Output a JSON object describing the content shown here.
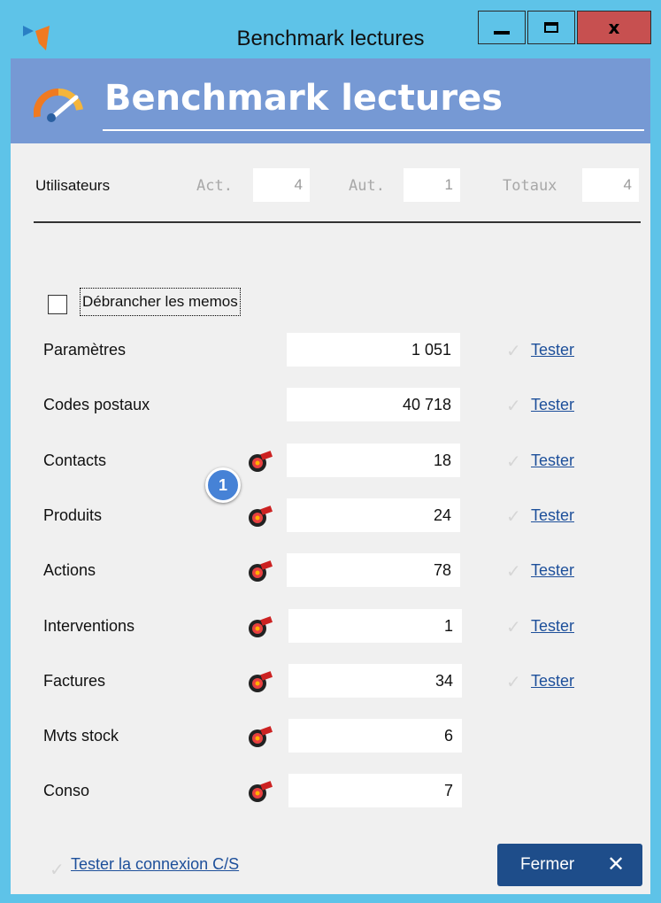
{
  "window": {
    "title": "Benchmark lectures",
    "controls": {
      "minimize": "minimize",
      "maximize": "maximize",
      "close": "x"
    }
  },
  "header": {
    "title": "Benchmark lectures",
    "icon": "speedometer-icon"
  },
  "users": {
    "label": "Utilisateurs",
    "fields": [
      {
        "label": "Act.",
        "value": "4"
      },
      {
        "label": "Aut.",
        "value": "1"
      },
      {
        "label": "Totaux",
        "value": "4"
      }
    ]
  },
  "memos_checkbox": {
    "label": "Débrancher les memos",
    "checked": false
  },
  "rows": [
    {
      "label": "Paramètres",
      "value": "1 051",
      "tester": "Tester",
      "has_icon": false
    },
    {
      "label": "Codes postaux",
      "value": "40 718",
      "tester": "Tester",
      "has_icon": false
    },
    {
      "label": "Contacts",
      "value": "18",
      "tester": "Tester",
      "has_icon": true
    },
    {
      "label": "Produits",
      "value": "24",
      "tester": "Tester",
      "has_icon": true
    },
    {
      "label": "Actions",
      "value": "78",
      "tester": "Tester",
      "has_icon": true
    },
    {
      "label": "Interventions",
      "value": "1",
      "tester": "Tester",
      "has_icon": true
    },
    {
      "label": "Factures",
      "value": "34",
      "tester": "Tester",
      "has_icon": true
    },
    {
      "label": "Mvts stock",
      "value": "6",
      "tester": "",
      "has_icon": true
    },
    {
      "label": "Conso",
      "value": "7",
      "tester": "",
      "has_icon": true
    }
  ],
  "badge": {
    "number": "1"
  },
  "footer": {
    "link": "Tester la connexion C/S",
    "close_button": "Fermer",
    "close_glyph": "✕"
  },
  "colors": {
    "titlebar": "#5ec3e8",
    "header": "#7699d4",
    "link": "#1d4f9a",
    "primary_button": "#1e4d8a",
    "badge": "#4682d6"
  }
}
